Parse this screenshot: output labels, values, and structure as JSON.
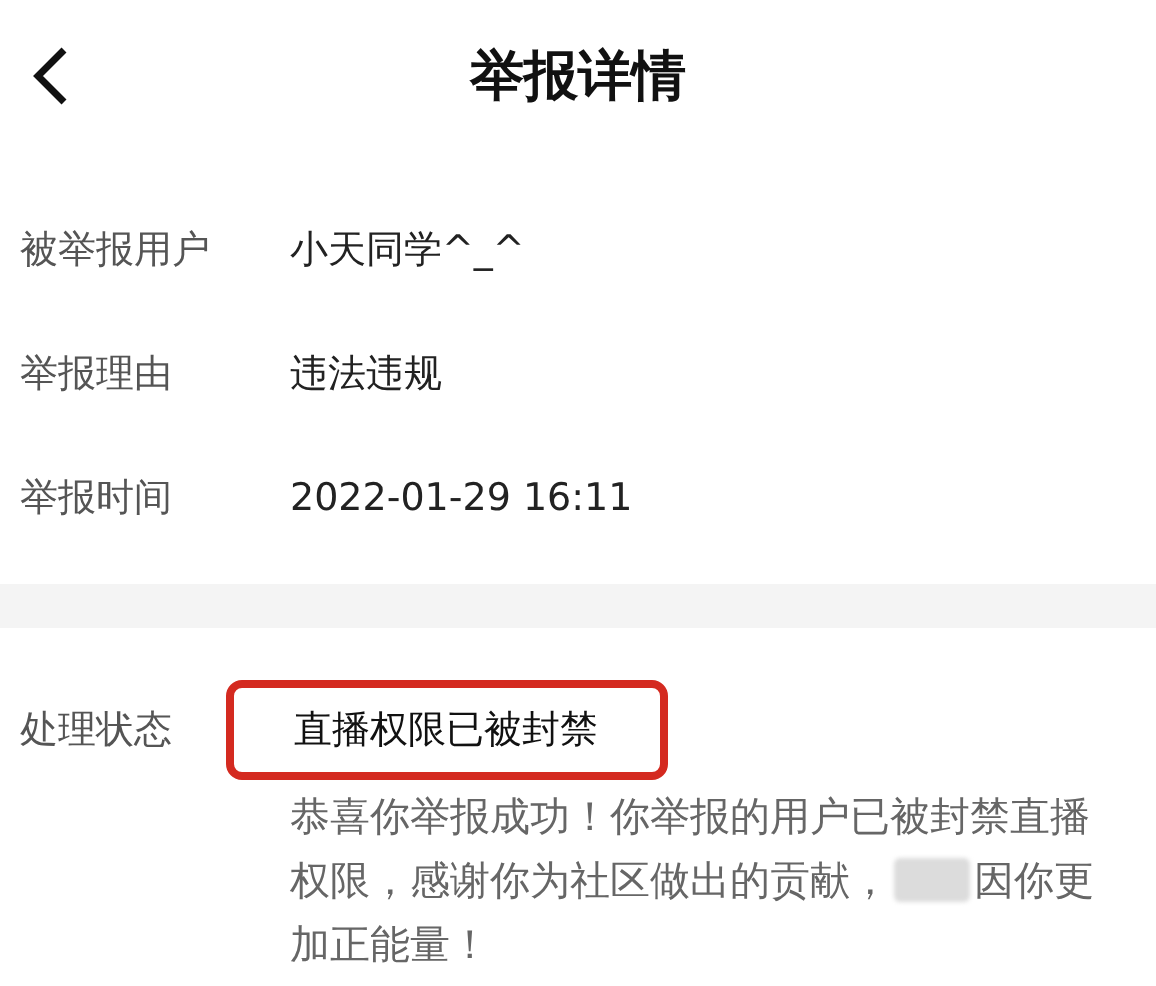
{
  "header": {
    "title": "举报详情"
  },
  "details": [
    {
      "label": "被举报用户",
      "value": "小天同学^_^"
    },
    {
      "label": "举报理由",
      "value": "违法违规"
    },
    {
      "label": "举报时间",
      "value": "2022-01-29 16:11"
    }
  ],
  "status": {
    "label": "处理状态",
    "value": "直播权限已被封禁",
    "highlighted": true,
    "message_lines": [
      [
        "恭喜你举报成功！你举报的用户已被封禁直播"
      ],
      [
        "权限，感谢你为社区做出的贡献，",
        "因你更"
      ],
      [
        "加正能量！"
      ]
    ]
  }
}
